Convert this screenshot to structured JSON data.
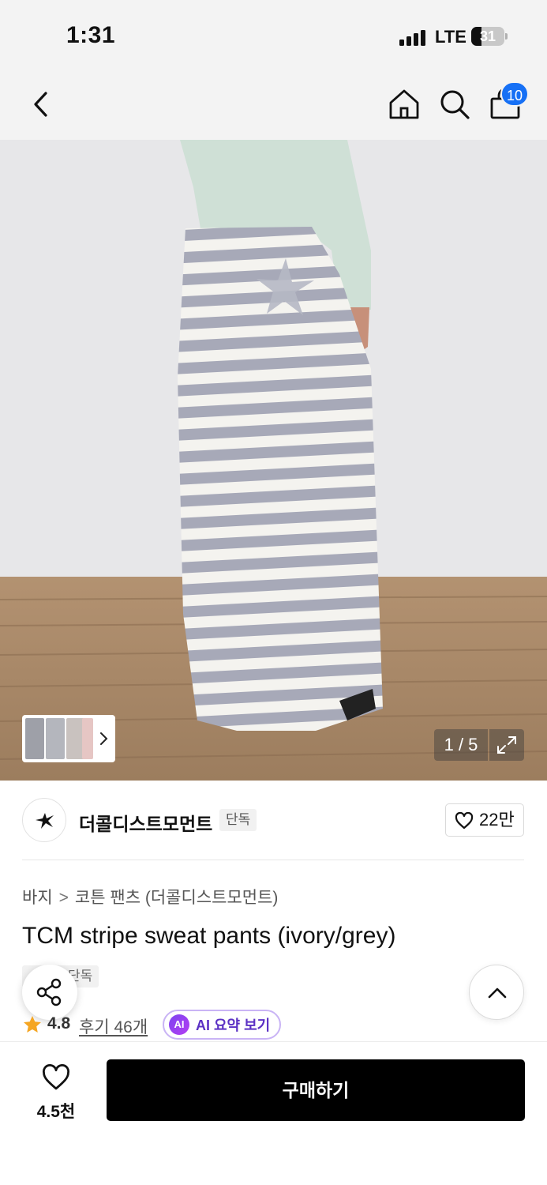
{
  "status_bar": {
    "time": "1:31",
    "network": "LTE",
    "battery": "31",
    "battery_level": 0.31
  },
  "nav": {
    "cart_count": "10",
    "icons": [
      "back-icon",
      "home-icon",
      "search-icon",
      "shopping-bag-icon"
    ]
  },
  "gallery": {
    "counter": "1 / 5"
  },
  "brand": {
    "name": "더콜디스트모먼트",
    "tag": "단독",
    "likes": "22만"
  },
  "breadcrumb": {
    "category": "바지",
    "subcategory": "코튼 팬츠 (더콜디스트모먼트)"
  },
  "product": {
    "title": "TCM stripe sweat pants (ivory/grey)",
    "tag": "단독",
    "rating": "4.8",
    "reviews": "후기 46개",
    "ai_badge": "AI",
    "ai_summary": "AI 요약 보기"
  },
  "bottom_bar": {
    "wish_count": "4.5천",
    "buy_label": "구매하기"
  },
  "colors": {
    "accent_blue": "#1670f5",
    "star": "#f5a623",
    "ai_purple": "#7d45f0",
    "buy_button": "#000000"
  }
}
